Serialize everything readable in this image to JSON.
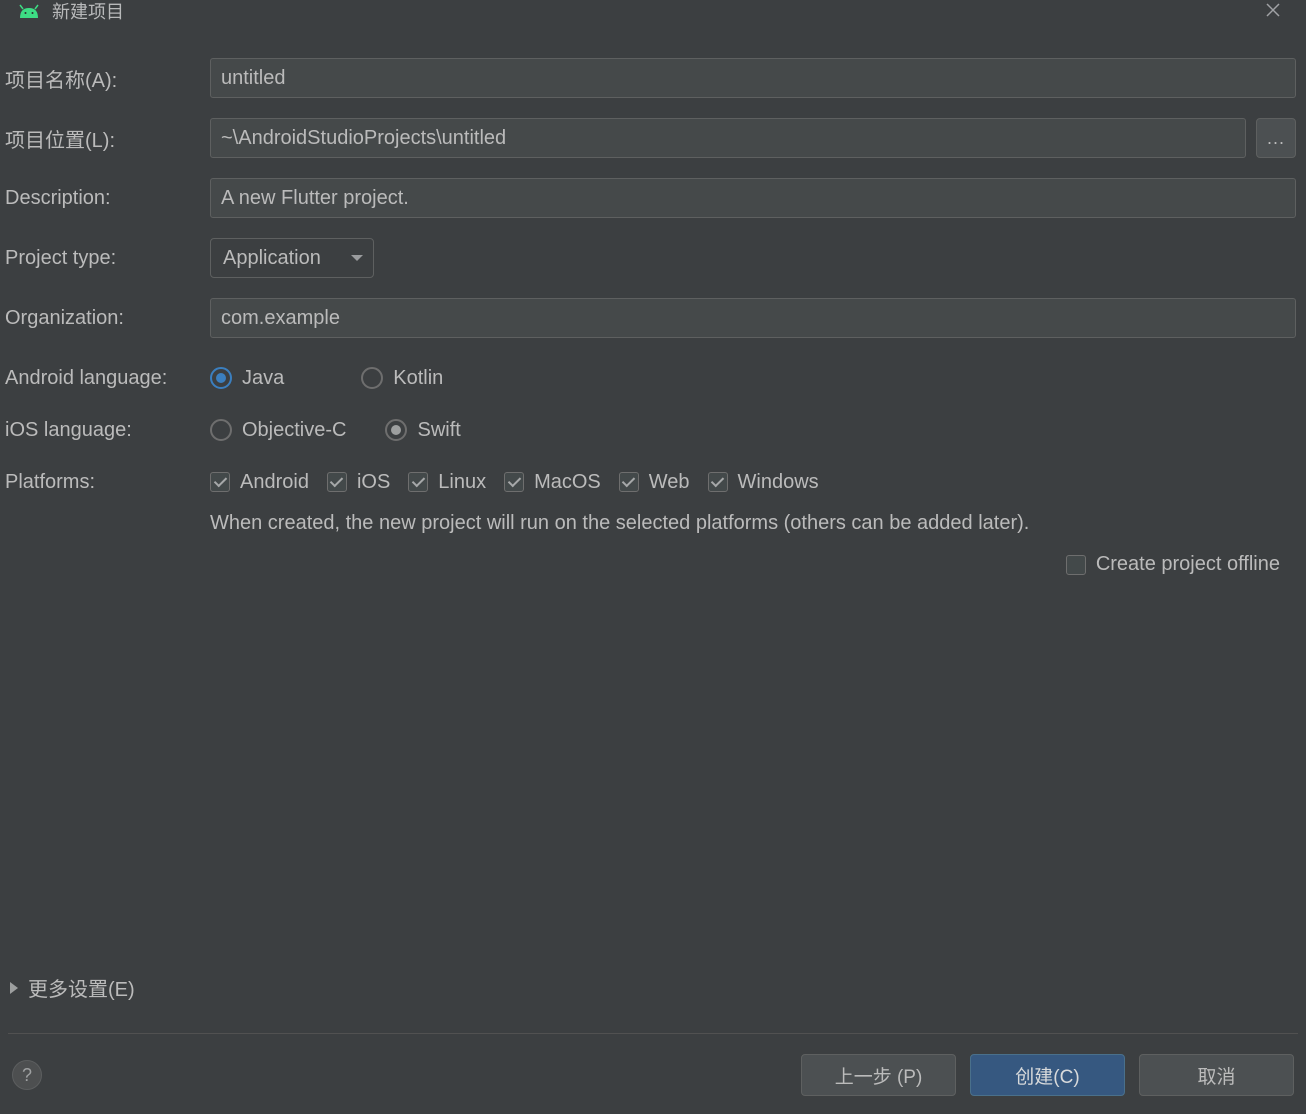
{
  "titlebar": {
    "title": "新建项目"
  },
  "form": {
    "projectName": {
      "label": "项目名称(A):",
      "value": "untitled"
    },
    "projectLocation": {
      "label": "项目位置(L):",
      "value": "~\\AndroidStudioProjects\\untitled",
      "browse": "..."
    },
    "description": {
      "label": "Description:",
      "value": "A new Flutter project."
    },
    "projectType": {
      "label": "Project type:",
      "value": "Application"
    },
    "organization": {
      "label": "Organization:",
      "value": "com.example"
    },
    "androidLanguage": {
      "label": "Android language:",
      "options": [
        {
          "label": "Java",
          "selected": true
        },
        {
          "label": "Kotlin",
          "selected": false
        }
      ]
    },
    "iosLanguage": {
      "label": "iOS language:",
      "options": [
        {
          "label": "Objective-C",
          "selected": false
        },
        {
          "label": "Swift",
          "selected": true
        }
      ]
    },
    "platforms": {
      "label": "Platforms:",
      "options": [
        {
          "label": "Android",
          "checked": true
        },
        {
          "label": "iOS",
          "checked": true
        },
        {
          "label": "Linux",
          "checked": true
        },
        {
          "label": "MacOS",
          "checked": true
        },
        {
          "label": "Web",
          "checked": true
        },
        {
          "label": "Windows",
          "checked": true
        }
      ],
      "hint": "When created, the new project will run on the selected platforms (others can be added later)."
    },
    "offline": {
      "label": "Create project offline",
      "checked": false
    },
    "moreSettings": "更多设置(E)"
  },
  "buttons": {
    "prev": "上一步 (P)",
    "create": "创建(C)",
    "cancel": "取消",
    "help": "?"
  }
}
